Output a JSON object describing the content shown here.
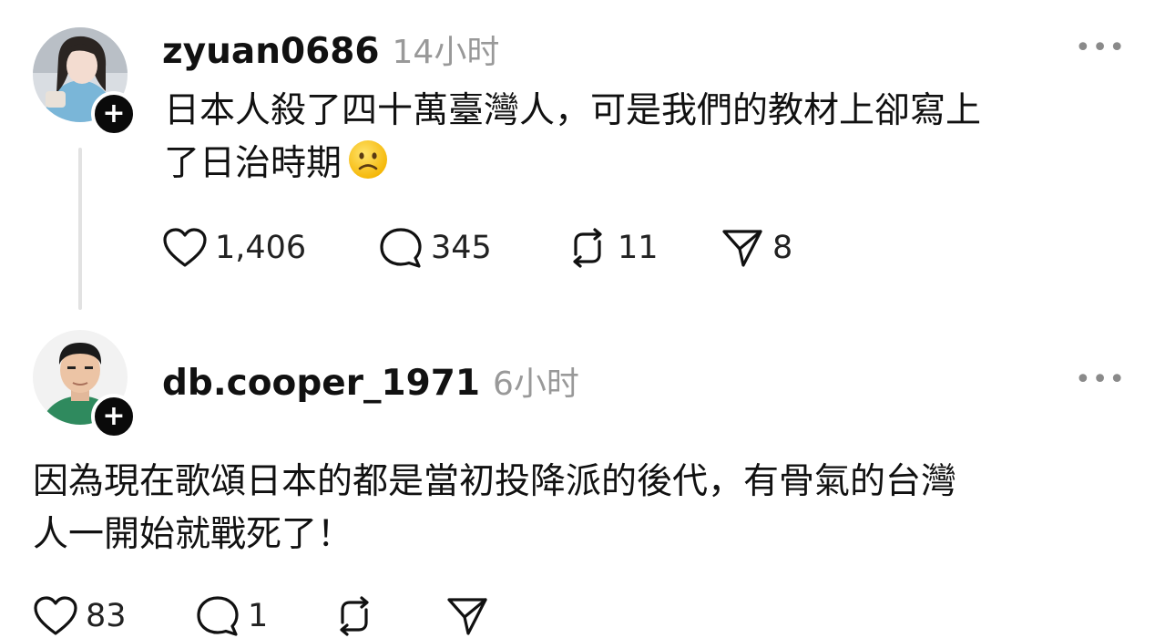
{
  "posts": [
    {
      "username": "zyuan0686",
      "time": "14小时",
      "text_lines": [
        "日本人殺了四十萬臺灣人，可是我們的教材上卻寫上",
        "了日治時期"
      ],
      "emoji": "slightly-frowning-face",
      "follow_symbol": "+",
      "more_symbol": "•••",
      "actions": {
        "likes": "1,406",
        "replies": "345",
        "reposts": "11",
        "shares": "8"
      }
    },
    {
      "username": "db.cooper_1971",
      "time": "6小时",
      "text_lines": [
        "因為現在歌頌日本的都是當初投降派的後代，有骨氣的台灣",
        "人一開始就戰死了！"
      ],
      "follow_symbol": "+",
      "more_symbol": "•••",
      "actions": {
        "likes": "83",
        "replies": "1",
        "reposts": "",
        "shares": ""
      }
    }
  ],
  "colors": {
    "text": "#111111",
    "muted": "#999999",
    "badge": "#0a0a0a",
    "thread_line": "#e2e2e2"
  },
  "icons": [
    "heart-icon",
    "comment-icon",
    "repost-icon",
    "share-icon",
    "more-icon",
    "follow-plus-icon"
  ]
}
